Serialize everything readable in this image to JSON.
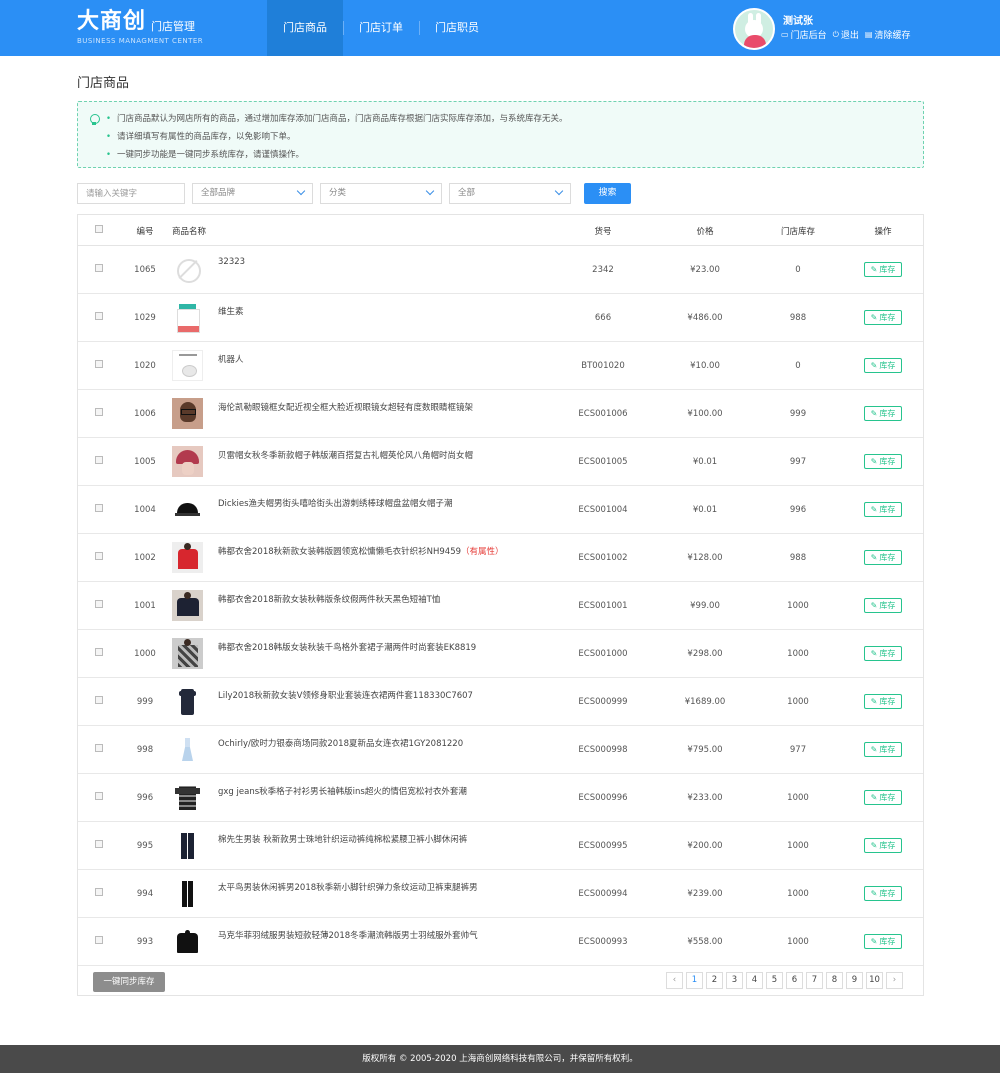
{
  "header": {
    "logo": "大商创",
    "logo_sub": "BUSINESS MANAGMENT CENTER",
    "app_name": "门店管理",
    "tabs": [
      {
        "label": "门店商品",
        "active": true
      },
      {
        "label": "门店订单",
        "active": false
      },
      {
        "label": "门店职员",
        "active": false
      }
    ],
    "user": {
      "name": "测试张",
      "links": [
        {
          "label": "门店后台",
          "icon": "store-icon"
        },
        {
          "label": "退出",
          "icon": "logout-icon"
        },
        {
          "label": "清除缓存",
          "icon": "clear-cache-icon"
        }
      ]
    },
    "accent_color": "#2b8ff5"
  },
  "page": {
    "title": "门店商品",
    "notice": [
      "门店商品默认为网店所有的商品，通过增加库存添加门店商品，门店商品库存根据门店实际库存添加，与系统库存无关。",
      "请详细填写有属性的商品库存，以免影响下单。",
      "一键同步功能是一键同步系统库存，请谨慎操作。"
    ]
  },
  "filters": {
    "keyword_placeholder": "请输入关键字",
    "brand": "全部品牌",
    "category": "分类",
    "scope": "全部",
    "search_label": "搜索"
  },
  "table": {
    "headers": {
      "id": "编号",
      "name": "商品名称",
      "sku": "货号",
      "price": "价格",
      "stock": "门店库存",
      "op": "操作"
    },
    "stock_button": "库存",
    "rows": [
      {
        "id": "1065",
        "name": "32323",
        "attr": "",
        "sku": "2342",
        "price": "¥23.00",
        "stock": "0",
        "thumb": "t-noimg"
      },
      {
        "id": "1029",
        "name": "维生素",
        "attr": "",
        "sku": "666",
        "price": "¥486.00",
        "stock": "988",
        "thumb": "t-jar"
      },
      {
        "id": "1020",
        "name": "机器人",
        "attr": "",
        "sku": "BT001020",
        "price": "¥10.00",
        "stock": "0",
        "thumb": "t-mouse"
      },
      {
        "id": "1006",
        "name": "海伦凯勒眼镜框女配近视全框大脸近视眼镜女超轻有度数眼睛框镜架",
        "attr": "",
        "sku": "ECS001006",
        "price": "¥100.00",
        "stock": "999",
        "thumb": "t-glasses"
      },
      {
        "id": "1005",
        "name": "贝雷帽女秋冬季新款帽子韩版潮百搭复古礼帽英伦风八角帽时尚女帽",
        "attr": "",
        "sku": "ECS001005",
        "price": "¥0.01",
        "stock": "997",
        "thumb": "t-hat"
      },
      {
        "id": "1004",
        "name": "Dickies渔夫帽男街头嘻哈街头出游刺绣棒球帽盘盆帽女帽子潮",
        "attr": "",
        "sku": "ECS001004",
        "price": "¥0.01",
        "stock": "996",
        "thumb": "t-cap"
      },
      {
        "id": "1002",
        "name": "韩都衣舍2018秋新款女装韩版圆领宽松慵懒毛衣针织衫NH9459",
        "attr": "（有属性）",
        "sku": "ECS001002",
        "price": "¥128.00",
        "stock": "988",
        "thumb": "t-red"
      },
      {
        "id": "1001",
        "name": "韩都衣舍2018新款女装秋韩版条纹假两件秋天黑色短袖T恤",
        "attr": "",
        "sku": "ECS001001",
        "price": "¥99.00",
        "stock": "1000",
        "thumb": "t-navy"
      },
      {
        "id": "1000",
        "name": "韩都衣舍2018韩版女装秋装千鸟格外套裙子潮两件时尚套装EK8819",
        "attr": "",
        "sku": "ECS001000",
        "price": "¥298.00",
        "stock": "1000",
        "thumb": "t-plaid"
      },
      {
        "id": "999",
        "name": "Lily2018秋新款女装V领修身职业套装连衣裙两件套118330C7607",
        "attr": "",
        "sku": "ECS000999",
        "price": "¥1689.00",
        "stock": "1000",
        "thumb": "t-suit"
      },
      {
        "id": "998",
        "name": "Ochirly/欧时力银泰商场同款2018夏新品女连衣裙1GY2081220",
        "attr": "",
        "sku": "ECS000998",
        "price": "¥795.00",
        "stock": "977",
        "thumb": "t-dress"
      },
      {
        "id": "996",
        "name": "gxg jeans秋季格子衬衫男长袖韩版ins超火的情侣宽松衬衣外套潮",
        "attr": "",
        "sku": "ECS000996",
        "price": "¥233.00",
        "stock": "1000",
        "thumb": "t-shirt"
      },
      {
        "id": "995",
        "name": "棉先生男装 秋新款男士珠地针织运动裤纯棉松紧腰卫裤小脚休闲裤",
        "attr": "",
        "sku": "ECS000995",
        "price": "¥200.00",
        "stock": "1000",
        "thumb": "t-pants"
      },
      {
        "id": "994",
        "name": "太平鸟男装休闲裤男2018秋季新小脚针织弹力条纹运动卫裤束腿裤男",
        "attr": "",
        "sku": "ECS000994",
        "price": "¥239.00",
        "stock": "1000",
        "thumb": "t-pants2"
      },
      {
        "id": "993",
        "name": "马克华菲羽绒服男装短款轻薄2018冬季潮流韩版男士羽绒服外套帅气",
        "attr": "",
        "sku": "ECS000993",
        "price": "¥558.00",
        "stock": "1000",
        "thumb": "t-jacket"
      }
    ]
  },
  "pagination": {
    "prev": "‹",
    "next": "›",
    "current": "1",
    "pages": [
      "1",
      "2",
      "3",
      "4",
      "5",
      "6",
      "7",
      "8",
      "9",
      "10"
    ]
  },
  "sync_button": "一键同步库存",
  "footer": "版权所有 © 2005-2020 上海商创网络科技有限公司，并保留所有权利。"
}
